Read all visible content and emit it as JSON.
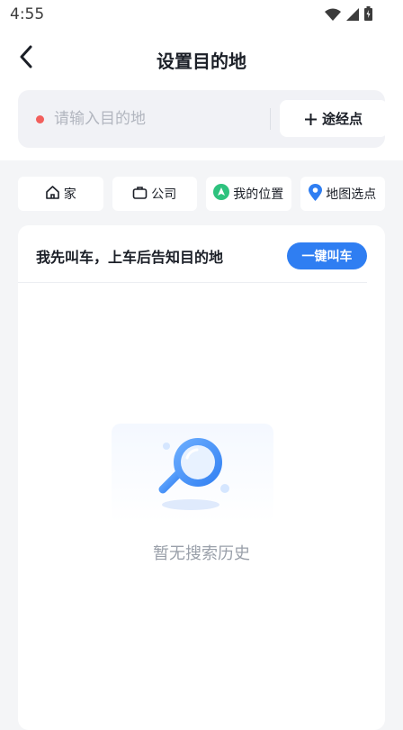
{
  "status_bar": {
    "time": "4:55"
  },
  "header": {
    "title": "设置目的地"
  },
  "search": {
    "placeholder": "请输入目的地",
    "value": "",
    "waypoint_label": "途经点"
  },
  "quick_actions": [
    {
      "label": "家",
      "icon": "home-icon"
    },
    {
      "label": "公司",
      "icon": "briefcase-icon"
    },
    {
      "label": "我的位置",
      "icon": "my-location-icon"
    },
    {
      "label": "地图选点",
      "icon": "map-pin-icon"
    }
  ],
  "card": {
    "hint": "我先叫车，上车后告知目的地",
    "button_label": "一键叫车"
  },
  "empty_state": {
    "text": "暂无搜索历史"
  },
  "colors": {
    "accent": "#2f7ef2",
    "dot": "#f25f5c",
    "location_green": "#2ec27e"
  }
}
